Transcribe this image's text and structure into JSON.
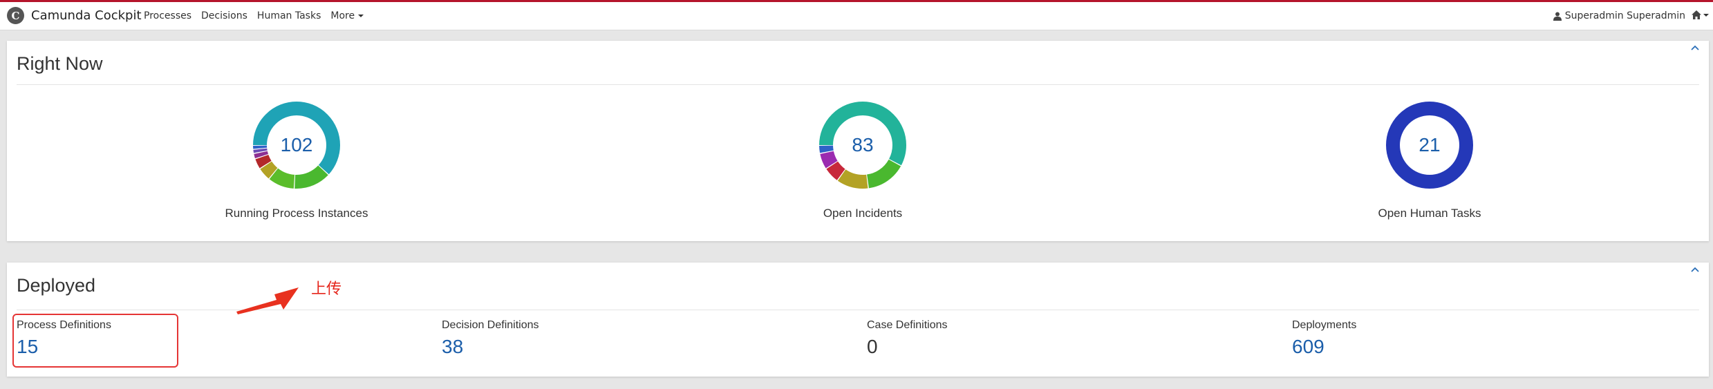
{
  "app": {
    "logo_letter": "C",
    "title": "Camunda Cockpit"
  },
  "nav": {
    "items": [
      "Processes",
      "Decisions",
      "Human Tasks",
      "More"
    ]
  },
  "user": {
    "name": "Superadmin Superadmin",
    "icon": "user-icon"
  },
  "home": {
    "icon": "home-icon"
  },
  "right_now": {
    "title": "Right Now",
    "widgets": [
      {
        "label": "Running Process Instances",
        "value": "102",
        "segments": [
          {
            "fraction": 0.62,
            "color": "#1fa3b6"
          },
          {
            "fraction": 0.14,
            "color": "#4ab82f"
          },
          {
            "fraction": 0.1,
            "color": "#5bbd2b"
          },
          {
            "fraction": 0.05,
            "color": "#b3a225"
          },
          {
            "fraction": 0.04,
            "color": "#b3282a"
          },
          {
            "fraction": 0.02,
            "color": "#8c2f93"
          },
          {
            "fraction": 0.015,
            "color": "#6a4bb5"
          },
          {
            "fraction": 0.015,
            "color": "#2f62c7"
          }
        ]
      },
      {
        "label": "Open Incidents",
        "value": "83",
        "segments": [
          {
            "fraction": 0.58,
            "color": "#22b39a"
          },
          {
            "fraction": 0.15,
            "color": "#4ab82f"
          },
          {
            "fraction": 0.12,
            "color": "#b3a225"
          },
          {
            "fraction": 0.06,
            "color": "#c7283a"
          },
          {
            "fraction": 0.06,
            "color": "#9b2bb0"
          },
          {
            "fraction": 0.03,
            "color": "#2f62c7"
          }
        ]
      },
      {
        "label": "Open Human Tasks",
        "value": "21",
        "segments": [
          {
            "fraction": 1.0,
            "color": "#2438b8"
          }
        ]
      }
    ]
  },
  "deployed": {
    "title": "Deployed",
    "stats": [
      {
        "label": "Process Definitions",
        "value": "15"
      },
      {
        "label": "Decision Definitions",
        "value": "38"
      },
      {
        "label": "Case Definitions",
        "value": "0"
      },
      {
        "label": "Deployments",
        "value": "609"
      }
    ],
    "annotation": "上传"
  }
}
